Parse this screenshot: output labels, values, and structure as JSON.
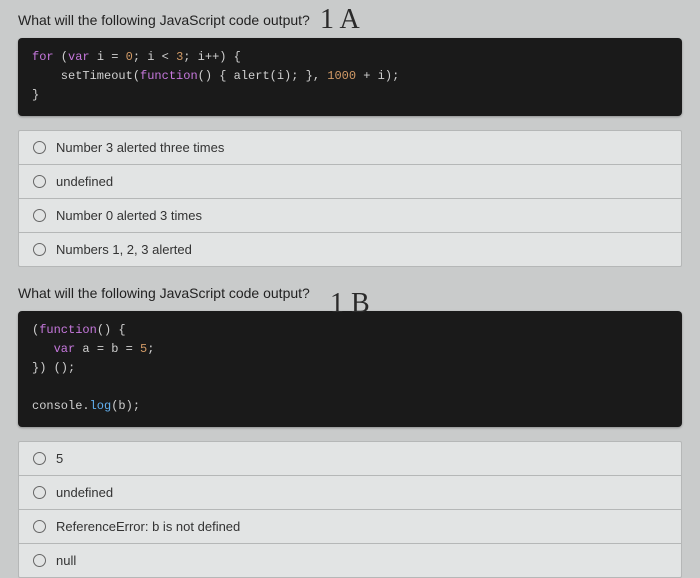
{
  "q1": {
    "prompt": "What will the following JavaScript code output?",
    "annotation": "1 A",
    "code": {
      "line1_for": "for",
      "line1_rest1": " (",
      "line1_var": "var",
      "line1_rest2": " i = ",
      "line1_zero": "0",
      "line1_rest3": "; i < ",
      "line1_three": "3",
      "line1_rest4": "; i++) {",
      "line2_indent": "    setTimeout(",
      "line2_function": "function",
      "line2_rest1": "() { alert(i); }, ",
      "line2_thousand": "1000",
      "line2_rest2": " + i);",
      "line3": "}"
    },
    "options": [
      {
        "label": "Number 3 alerted three times"
      },
      {
        "label": "undefined"
      },
      {
        "label": "Number 0 alerted 3 times"
      },
      {
        "label": "Numbers 1, 2, 3 alerted"
      }
    ]
  },
  "q2": {
    "prompt": "What will the following JavaScript code output?",
    "annotation": "1 B",
    "code": {
      "line1_a": "(",
      "line1_function": "function",
      "line1_b": "() {",
      "line2_indent": "   ",
      "line2_var": "var",
      "line2_rest": " a = b = ",
      "line2_five": "5",
      "line2_semi": ";",
      "line3": "}) ();",
      "line4": "",
      "line5_a": "console.",
      "line5_log": "log",
      "line5_b": "(b);"
    },
    "options": [
      {
        "label": "5"
      },
      {
        "label": "undefined"
      },
      {
        "label": "ReferenceError: b is not defined"
      },
      {
        "label": "null"
      }
    ]
  }
}
